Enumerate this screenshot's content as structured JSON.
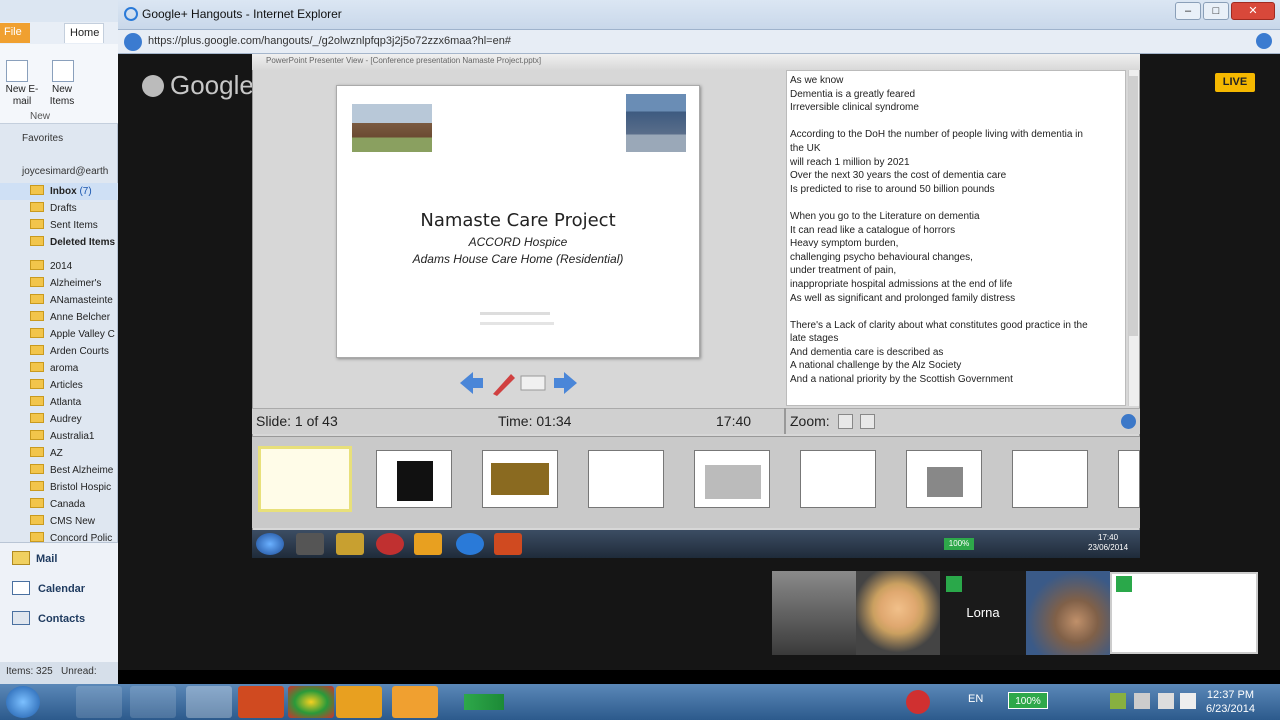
{
  "outlook": {
    "tab_file": "File",
    "tab_home": "Home",
    "new_email": "New E-mail",
    "new_items": "New Items",
    "group_new": "New",
    "favorites": "Favorites",
    "account": "joycesimard@earth",
    "folders_top": [
      {
        "label": "Inbox",
        "count": "(7)"
      },
      {
        "label": "Drafts"
      },
      {
        "label": "Sent Items"
      },
      {
        "label": "Deleted Items"
      }
    ],
    "folders": [
      "2014",
      "Alzheimer's",
      "ANamasteinte",
      "Anne Belcher",
      "Apple Valley C",
      "Arden Courts",
      "aroma",
      "Articles",
      "Atlanta",
      "Audrey",
      "Australia1",
      "AZ",
      "Best Alzheime",
      "Bristol Hospic",
      "Canada",
      "CMS New",
      "Concord Polic"
    ],
    "nav": {
      "mail": "Mail",
      "calendar": "Calendar",
      "contacts": "Contacts"
    },
    "status_items": "Items: 325",
    "status_unread": "Unread:"
  },
  "browser": {
    "title": "Google+ Hangouts - Internet Explorer",
    "url": "https://plus.google.com/hangouts/_/g2olwznlpfqp3j2j5o72zzx6maa?hl=en#",
    "logo": "Google+",
    "live_badge": "LIVE"
  },
  "presenter": {
    "window_title": "PowerPoint Presenter View - [Conference presentation Namaste Project.pptx]",
    "slide_title": "Namaste Care Project",
    "slide_sub1": "ACCORD Hospice",
    "slide_sub2": "Adams House Care Home (Residential)",
    "slide_counter": "Slide: 1 of 43",
    "elapsed": "Time: 01:34",
    "clock": "17:40",
    "zoom_label": "Zoom:",
    "notes": [
      "As we know",
      "Dementia is a greatly feared",
      "Irreversible clinical syndrome",
      "",
      "According to the DoH the number of people living with dementia in",
      "the UK",
      "will reach 1 million by 2021",
      "Over the next 30 years the cost of dementia care",
      "Is predicted to rise to around 50 billion pounds",
      "",
      "When you go to the Literature on dementia",
      "It can read like a catalogue of horrors",
      "Heavy symptom burden,",
      "challenging psycho behavioural changes,",
      "under treatment of pain,",
      "inappropriate hospital admissions at the end of life",
      "As well as significant and prolonged family distress",
      "",
      "There's a Lack of clarity about what constitutes good practice in the",
      "late stages",
      "And dementia care is described as",
      "A national challenge by the Alz Society",
      "And a national priority by the Scottish Government"
    ]
  },
  "inner_taskbar": {
    "battery": "100%",
    "time": "17:40",
    "date": "23/06/2014"
  },
  "participants": {
    "lorna": "Lorna"
  },
  "taskbar": {
    "lang": "EN",
    "battery": "100%",
    "time": "12:37 PM",
    "date": "6/23/2014"
  }
}
